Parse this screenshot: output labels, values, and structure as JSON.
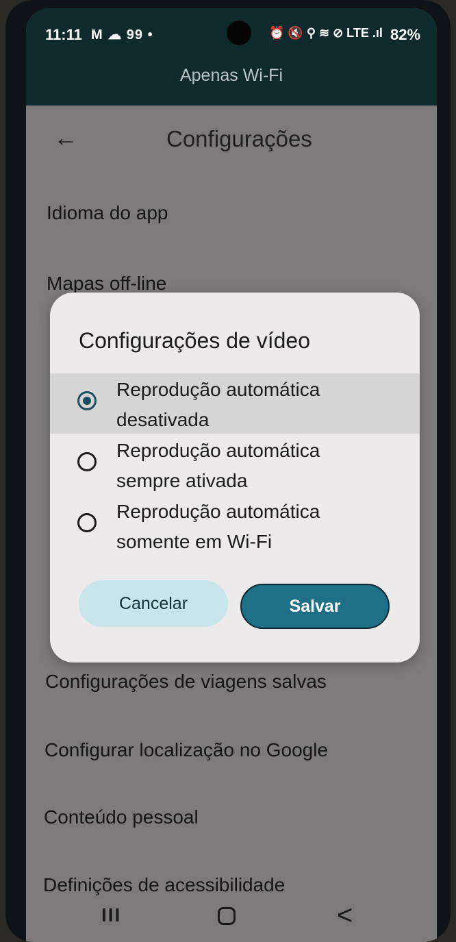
{
  "status_bar": {
    "time": "11:11",
    "left_icons": "M ☁ 99 •",
    "right_icons": "⏰ 🔇 ⚲ ≋ ⊘ LTE .ıl",
    "battery": "82%"
  },
  "banner": "Apenas Wi-Fi",
  "app_bar": {
    "back_icon": "arrow-left-icon",
    "title": "Configurações"
  },
  "settings": {
    "items": [
      "Idioma do app",
      "Mapas off-line",
      "Configurações de viagens salvas",
      "Configurar localização no Google",
      "Conteúdo pessoal",
      "Definições de acessibilidade"
    ]
  },
  "dialog": {
    "title": "Configurações de vídeo",
    "options": [
      {
        "line1": "Reprodução automática",
        "line2": "desativada",
        "selected": true
      },
      {
        "line1": "Reprodução automática",
        "line2": "sempre ativada",
        "selected": false
      },
      {
        "line1": "Reprodução automática",
        "line2": "somente em Wi-Fi",
        "selected": false
      }
    ],
    "cancel_label": "Cancelar",
    "save_label": "Salvar"
  },
  "nav_bar": {
    "recents_glyph": "III",
    "back_glyph": "<"
  },
  "colors": {
    "accent": "#1f6f86",
    "status_bar_bg": "#0f2a2c",
    "scrim": "#7c7a7b",
    "dialog_bg": "#eceaea",
    "cancel_bg": "#c8e6ea"
  }
}
